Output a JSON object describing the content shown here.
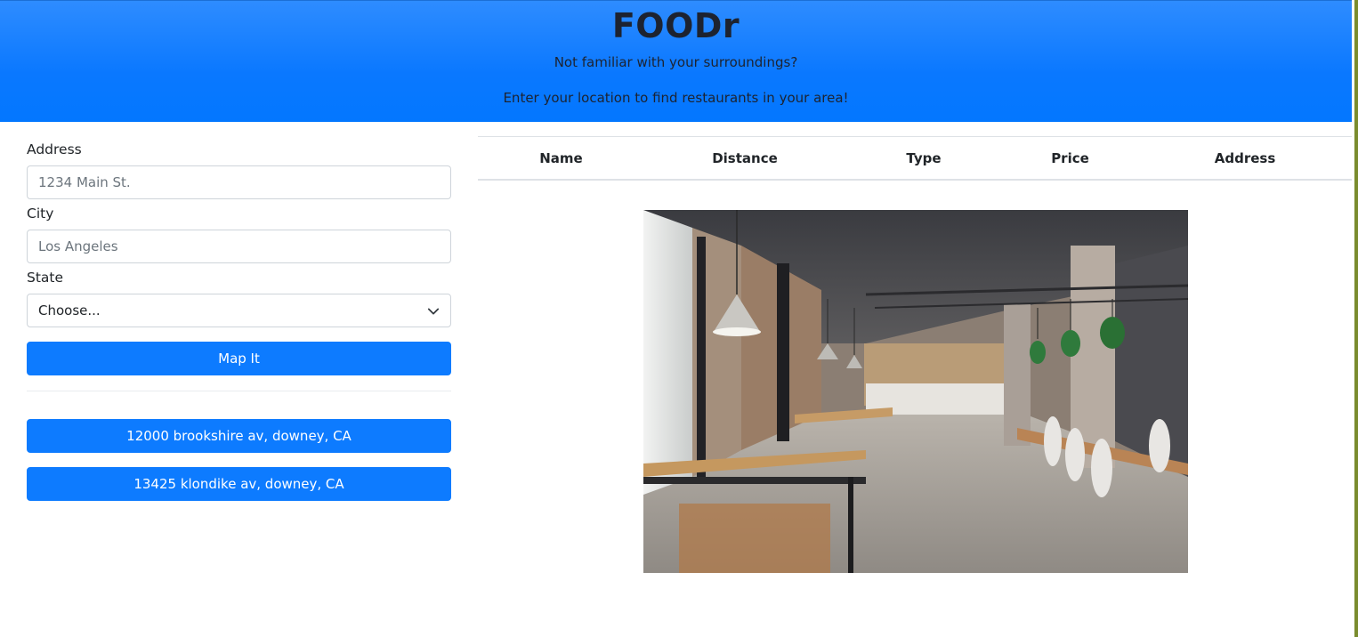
{
  "header": {
    "title": "FOODr",
    "tagline_1": "Not familiar with your surroundings?",
    "tagline_2": "Enter your location to find restaurants in your area!"
  },
  "form": {
    "address_label": "Address",
    "address_placeholder": "1234 Main St.",
    "city_label": "City",
    "city_placeholder": "Los Angeles",
    "state_label": "State",
    "state_selected": "Choose...",
    "submit_label": "Map It"
  },
  "history": [
    {
      "label": "12000 brookshire av, downey, CA"
    },
    {
      "label": "13425 klondike av, downey, CA"
    }
  ],
  "table": {
    "columns": [
      "Name",
      "Distance",
      "Type",
      "Price",
      "Address"
    ]
  },
  "hero_image": {
    "description_icon": "restaurant-interior-image"
  },
  "colors": {
    "brand_blue": "#0d7bff",
    "header_gradient_top": "#2e8cff",
    "header_gradient_bottom": "#0377ff",
    "title_text": "#1d2330"
  }
}
